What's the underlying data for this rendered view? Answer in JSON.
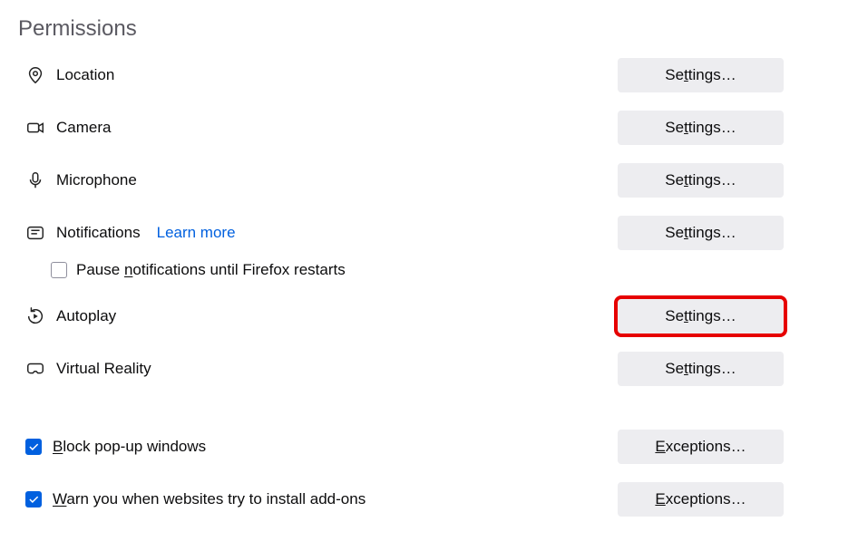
{
  "section_title": "Permissions",
  "items": {
    "location": {
      "label": "Location",
      "button": "Settings…"
    },
    "camera": {
      "label": "Camera",
      "button": "Settings…"
    },
    "microphone": {
      "label": "Microphone",
      "button": "Settings…"
    },
    "notifications": {
      "label": "Notifications",
      "learn_more": "Learn more",
      "button": "Settings…"
    },
    "pause_notifications": {
      "label_pre": "Pause ",
      "label_accel": "n",
      "label_post": "otifications until Firefox restarts",
      "checked": false
    },
    "autoplay": {
      "label": "Autoplay",
      "button": "Settings…",
      "highlighted": true
    },
    "virtual_reality": {
      "label": "Virtual Reality",
      "button": "Settings…"
    },
    "block_popups": {
      "label_accel": "B",
      "label_post": "lock pop-up windows",
      "checked": true,
      "button_accel": "E",
      "button_post": "xceptions…"
    },
    "warn_addons": {
      "label_accel": "W",
      "label_post": "arn you when websites try to install add-ons",
      "checked": true,
      "button_accel": "E",
      "button_post": "xceptions…"
    }
  },
  "button_settings_pre": "Se",
  "button_settings_accel": "t",
  "button_settings_post": "tings…"
}
